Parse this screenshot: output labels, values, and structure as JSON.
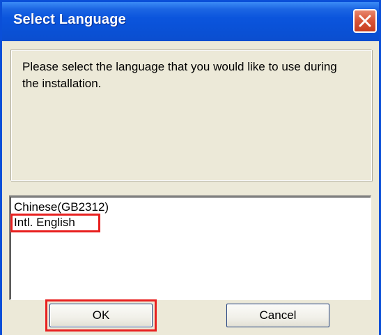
{
  "window": {
    "title": "Select Language"
  },
  "message": {
    "text": "Please select the language that you would like to use during the installation."
  },
  "languages": {
    "items": [
      {
        "label": "Chinese(GB2312)"
      },
      {
        "label": "Intl. English"
      }
    ],
    "highlighted": "Intl. English"
  },
  "buttons": {
    "ok_label": "OK",
    "cancel_label": "Cancel"
  },
  "colors": {
    "titlebar": "#0b55dd",
    "dialog_background": "#ece9d8",
    "annotation_highlight": "#e8201f",
    "close_button": "#d9573a"
  }
}
